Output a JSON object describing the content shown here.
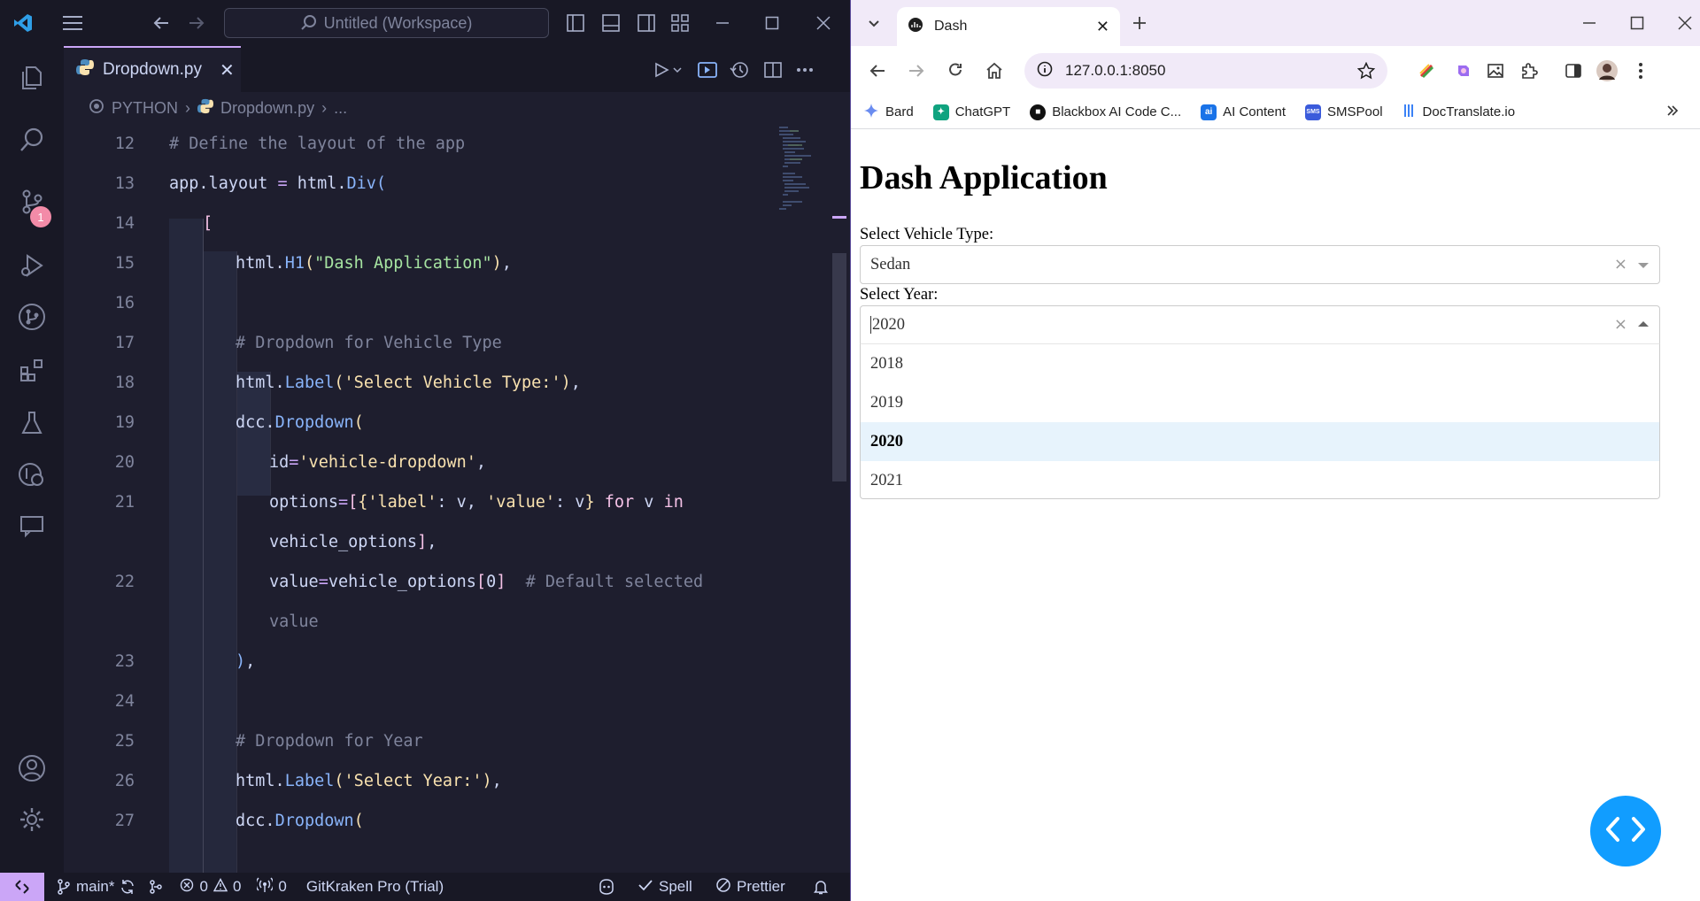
{
  "vscode": {
    "search_text": "Untitled (Workspace)",
    "source_control_badge": "1",
    "tab_filename": "Dropdown.py",
    "breadcrumb": {
      "root": "PYTHON",
      "file": "Dropdown.py",
      "more": "..."
    },
    "code_lines": [
      {
        "num": "12",
        "text": "# Define the layout of the app"
      },
      {
        "num": "13",
        "text": "app.layout = html.Div("
      },
      {
        "num": "14",
        "text": "["
      },
      {
        "num": "15",
        "text": "html.H1(\"Dash Application\"),"
      },
      {
        "num": "16",
        "text": ""
      },
      {
        "num": "17",
        "text": "# Dropdown for Vehicle Type"
      },
      {
        "num": "18",
        "text": "html.Label('Select Vehicle Type:'),"
      },
      {
        "num": "19",
        "text": "dcc.Dropdown("
      },
      {
        "num": "20",
        "text": "id='vehicle-dropdown',"
      },
      {
        "num": "21",
        "text": "options=[{'label': v, 'value': v} for v in"
      },
      {
        "num": "",
        "text": "vehicle_options],"
      },
      {
        "num": "22",
        "text": "value=vehicle_options[0]  # Default selected"
      },
      {
        "num": "",
        "text": "value"
      },
      {
        "num": "23",
        "text": "),"
      },
      {
        "num": "24",
        "text": ""
      },
      {
        "num": "25",
        "text": "# Dropdown for Year"
      },
      {
        "num": "26",
        "text": "html.Label('Select Year:'),"
      },
      {
        "num": "27",
        "text": "dcc.Dropdown("
      }
    ],
    "status": {
      "branch": "main*",
      "errors": "0",
      "warnings": "0",
      "ports": "0",
      "gitkraken": "GitKraken Pro (Trial)",
      "spell": "Spell",
      "prettier": "Prettier"
    }
  },
  "browser": {
    "tab_title": "Dash",
    "url": "127.0.0.1:8050",
    "bookmarks": [
      "Bard",
      "ChatGPT",
      "Blackbox AI Code C...",
      "AI Content",
      "SMSPool",
      "DocTranslate.io"
    ],
    "page": {
      "heading": "Dash Application",
      "vehicle_label": "Select Vehicle Type:",
      "vehicle_value": "Sedan",
      "year_label": "Select Year:",
      "year_value": "2020",
      "year_options": [
        "2018",
        "2019",
        "2020",
        "2021"
      ],
      "year_selected_index": 2
    }
  },
  "colors": {
    "vscode_bg": "#1e1e2e",
    "vscode_accent": "#cba6f7",
    "dash_selected_bg": "#e7f3fc",
    "dash_fab": "#119dff"
  }
}
